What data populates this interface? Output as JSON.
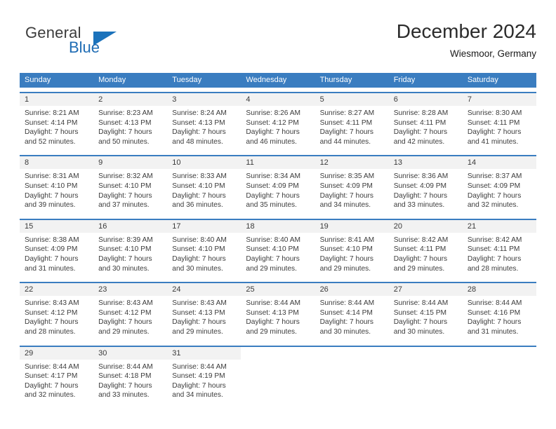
{
  "brand": {
    "name_part1": "General",
    "name_part2": "Blue",
    "triangle_color": "#1b72bb"
  },
  "header": {
    "title": "December 2024",
    "subtitle": "Wiesmoor, Germany"
  },
  "calendar": {
    "header_color": "#3a7dc0",
    "day_headers": [
      "Sunday",
      "Monday",
      "Tuesday",
      "Wednesday",
      "Thursday",
      "Friday",
      "Saturday"
    ],
    "weeks": [
      [
        {
          "day": "1",
          "sunrise": "Sunrise: 8:21 AM",
          "sunset": "Sunset: 4:14 PM",
          "daylight1": "Daylight: 7 hours",
          "daylight2": "and 52 minutes."
        },
        {
          "day": "2",
          "sunrise": "Sunrise: 8:23 AM",
          "sunset": "Sunset: 4:13 PM",
          "daylight1": "Daylight: 7 hours",
          "daylight2": "and 50 minutes."
        },
        {
          "day": "3",
          "sunrise": "Sunrise: 8:24 AM",
          "sunset": "Sunset: 4:13 PM",
          "daylight1": "Daylight: 7 hours",
          "daylight2": "and 48 minutes."
        },
        {
          "day": "4",
          "sunrise": "Sunrise: 8:26 AM",
          "sunset": "Sunset: 4:12 PM",
          "daylight1": "Daylight: 7 hours",
          "daylight2": "and 46 minutes."
        },
        {
          "day": "5",
          "sunrise": "Sunrise: 8:27 AM",
          "sunset": "Sunset: 4:11 PM",
          "daylight1": "Daylight: 7 hours",
          "daylight2": "and 44 minutes."
        },
        {
          "day": "6",
          "sunrise": "Sunrise: 8:28 AM",
          "sunset": "Sunset: 4:11 PM",
          "daylight1": "Daylight: 7 hours",
          "daylight2": "and 42 minutes."
        },
        {
          "day": "7",
          "sunrise": "Sunrise: 8:30 AM",
          "sunset": "Sunset: 4:11 PM",
          "daylight1": "Daylight: 7 hours",
          "daylight2": "and 41 minutes."
        }
      ],
      [
        {
          "day": "8",
          "sunrise": "Sunrise: 8:31 AM",
          "sunset": "Sunset: 4:10 PM",
          "daylight1": "Daylight: 7 hours",
          "daylight2": "and 39 minutes."
        },
        {
          "day": "9",
          "sunrise": "Sunrise: 8:32 AM",
          "sunset": "Sunset: 4:10 PM",
          "daylight1": "Daylight: 7 hours",
          "daylight2": "and 37 minutes."
        },
        {
          "day": "10",
          "sunrise": "Sunrise: 8:33 AM",
          "sunset": "Sunset: 4:10 PM",
          "daylight1": "Daylight: 7 hours",
          "daylight2": "and 36 minutes."
        },
        {
          "day": "11",
          "sunrise": "Sunrise: 8:34 AM",
          "sunset": "Sunset: 4:09 PM",
          "daylight1": "Daylight: 7 hours",
          "daylight2": "and 35 minutes."
        },
        {
          "day": "12",
          "sunrise": "Sunrise: 8:35 AM",
          "sunset": "Sunset: 4:09 PM",
          "daylight1": "Daylight: 7 hours",
          "daylight2": "and 34 minutes."
        },
        {
          "day": "13",
          "sunrise": "Sunrise: 8:36 AM",
          "sunset": "Sunset: 4:09 PM",
          "daylight1": "Daylight: 7 hours",
          "daylight2": "and 33 minutes."
        },
        {
          "day": "14",
          "sunrise": "Sunrise: 8:37 AM",
          "sunset": "Sunset: 4:09 PM",
          "daylight1": "Daylight: 7 hours",
          "daylight2": "and 32 minutes."
        }
      ],
      [
        {
          "day": "15",
          "sunrise": "Sunrise: 8:38 AM",
          "sunset": "Sunset: 4:09 PM",
          "daylight1": "Daylight: 7 hours",
          "daylight2": "and 31 minutes."
        },
        {
          "day": "16",
          "sunrise": "Sunrise: 8:39 AM",
          "sunset": "Sunset: 4:10 PM",
          "daylight1": "Daylight: 7 hours",
          "daylight2": "and 30 minutes."
        },
        {
          "day": "17",
          "sunrise": "Sunrise: 8:40 AM",
          "sunset": "Sunset: 4:10 PM",
          "daylight1": "Daylight: 7 hours",
          "daylight2": "and 30 minutes."
        },
        {
          "day": "18",
          "sunrise": "Sunrise: 8:40 AM",
          "sunset": "Sunset: 4:10 PM",
          "daylight1": "Daylight: 7 hours",
          "daylight2": "and 29 minutes."
        },
        {
          "day": "19",
          "sunrise": "Sunrise: 8:41 AM",
          "sunset": "Sunset: 4:10 PM",
          "daylight1": "Daylight: 7 hours",
          "daylight2": "and 29 minutes."
        },
        {
          "day": "20",
          "sunrise": "Sunrise: 8:42 AM",
          "sunset": "Sunset: 4:11 PM",
          "daylight1": "Daylight: 7 hours",
          "daylight2": "and 29 minutes."
        },
        {
          "day": "21",
          "sunrise": "Sunrise: 8:42 AM",
          "sunset": "Sunset: 4:11 PM",
          "daylight1": "Daylight: 7 hours",
          "daylight2": "and 28 minutes."
        }
      ],
      [
        {
          "day": "22",
          "sunrise": "Sunrise: 8:43 AM",
          "sunset": "Sunset: 4:12 PM",
          "daylight1": "Daylight: 7 hours",
          "daylight2": "and 28 minutes."
        },
        {
          "day": "23",
          "sunrise": "Sunrise: 8:43 AM",
          "sunset": "Sunset: 4:12 PM",
          "daylight1": "Daylight: 7 hours",
          "daylight2": "and 29 minutes."
        },
        {
          "day": "24",
          "sunrise": "Sunrise: 8:43 AM",
          "sunset": "Sunset: 4:13 PM",
          "daylight1": "Daylight: 7 hours",
          "daylight2": "and 29 minutes."
        },
        {
          "day": "25",
          "sunrise": "Sunrise: 8:44 AM",
          "sunset": "Sunset: 4:13 PM",
          "daylight1": "Daylight: 7 hours",
          "daylight2": "and 29 minutes."
        },
        {
          "day": "26",
          "sunrise": "Sunrise: 8:44 AM",
          "sunset": "Sunset: 4:14 PM",
          "daylight1": "Daylight: 7 hours",
          "daylight2": "and 30 minutes."
        },
        {
          "day": "27",
          "sunrise": "Sunrise: 8:44 AM",
          "sunset": "Sunset: 4:15 PM",
          "daylight1": "Daylight: 7 hours",
          "daylight2": "and 30 minutes."
        },
        {
          "day": "28",
          "sunrise": "Sunrise: 8:44 AM",
          "sunset": "Sunset: 4:16 PM",
          "daylight1": "Daylight: 7 hours",
          "daylight2": "and 31 minutes."
        }
      ],
      [
        {
          "day": "29",
          "sunrise": "Sunrise: 8:44 AM",
          "sunset": "Sunset: 4:17 PM",
          "daylight1": "Daylight: 7 hours",
          "daylight2": "and 32 minutes."
        },
        {
          "day": "30",
          "sunrise": "Sunrise: 8:44 AM",
          "sunset": "Sunset: 4:18 PM",
          "daylight1": "Daylight: 7 hours",
          "daylight2": "and 33 minutes."
        },
        {
          "day": "31",
          "sunrise": "Sunrise: 8:44 AM",
          "sunset": "Sunset: 4:19 PM",
          "daylight1": "Daylight: 7 hours",
          "daylight2": "and 34 minutes."
        },
        {
          "day": "",
          "sunrise": "",
          "sunset": "",
          "daylight1": "",
          "daylight2": ""
        },
        {
          "day": "",
          "sunrise": "",
          "sunset": "",
          "daylight1": "",
          "daylight2": ""
        },
        {
          "day": "",
          "sunrise": "",
          "sunset": "",
          "daylight1": "",
          "daylight2": ""
        },
        {
          "day": "",
          "sunrise": "",
          "sunset": "",
          "daylight1": "",
          "daylight2": ""
        }
      ]
    ]
  }
}
